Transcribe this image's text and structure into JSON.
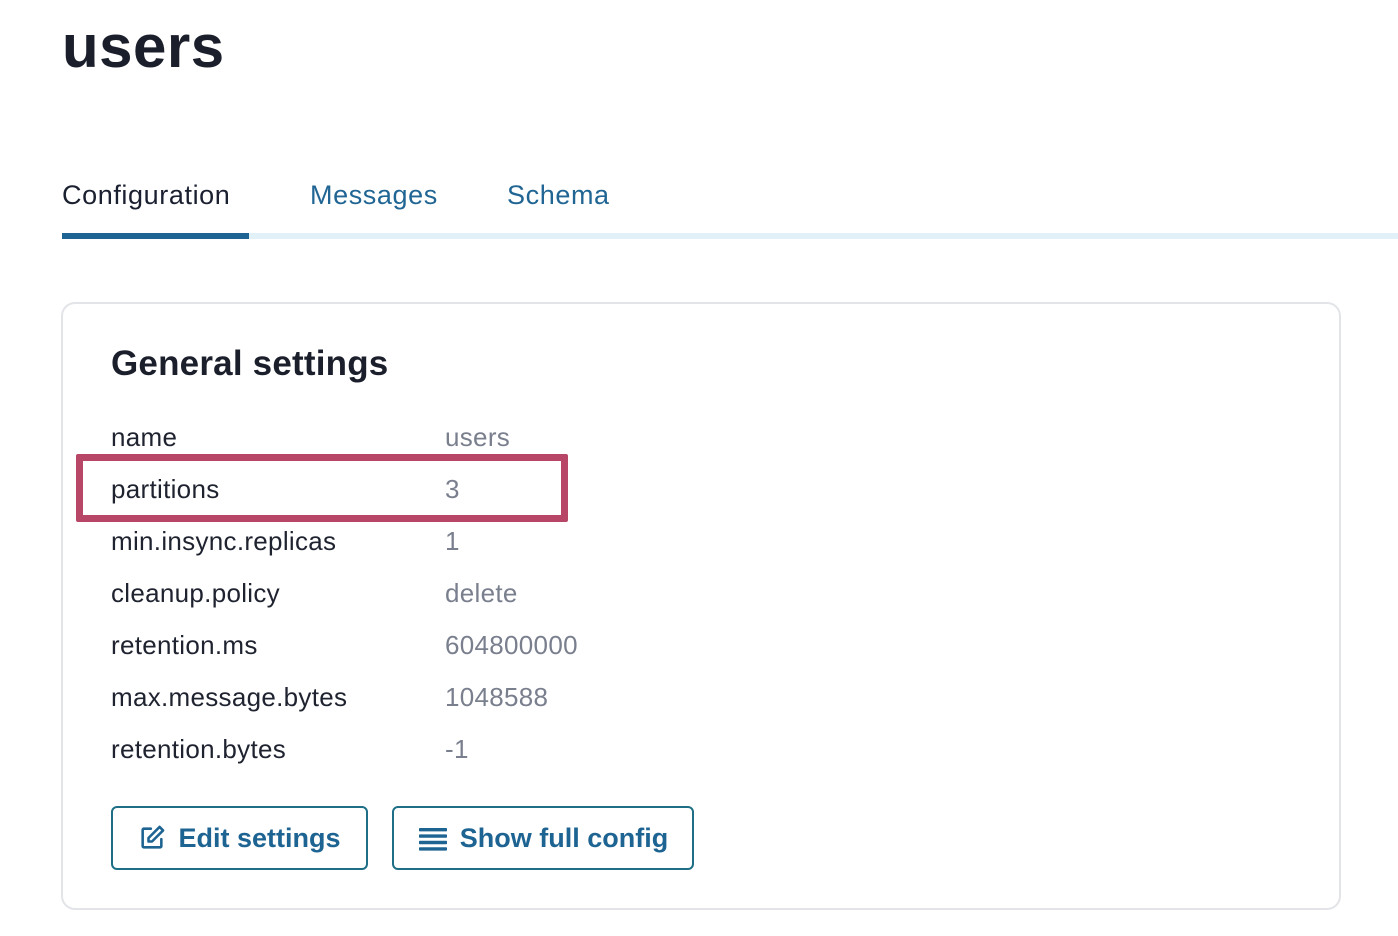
{
  "page": {
    "title": "users"
  },
  "tabs": [
    {
      "label": "Configuration",
      "active": true
    },
    {
      "label": "Messages",
      "active": false
    },
    {
      "label": "Schema",
      "active": false
    }
  ],
  "general_settings": {
    "title": "General settings",
    "rows": [
      {
        "key": "name",
        "value": "users"
      },
      {
        "key": "partitions",
        "value": "3",
        "highlighted": true
      },
      {
        "key": "min.insync.replicas",
        "value": "1"
      },
      {
        "key": "cleanup.policy",
        "value": "delete"
      },
      {
        "key": "retention.ms",
        "value": "604800000"
      },
      {
        "key": "max.message.bytes",
        "value": "1048588"
      },
      {
        "key": "retention.bytes",
        "value": "-1"
      }
    ],
    "buttons": {
      "edit_label": "Edit settings",
      "edit_icon": "edit-icon",
      "config_label": "Show full config",
      "config_icon": "list-icon"
    }
  },
  "colors": {
    "accent": "#1e6493",
    "highlight": "#b2375a",
    "muted_value": "#7a7f8e"
  }
}
